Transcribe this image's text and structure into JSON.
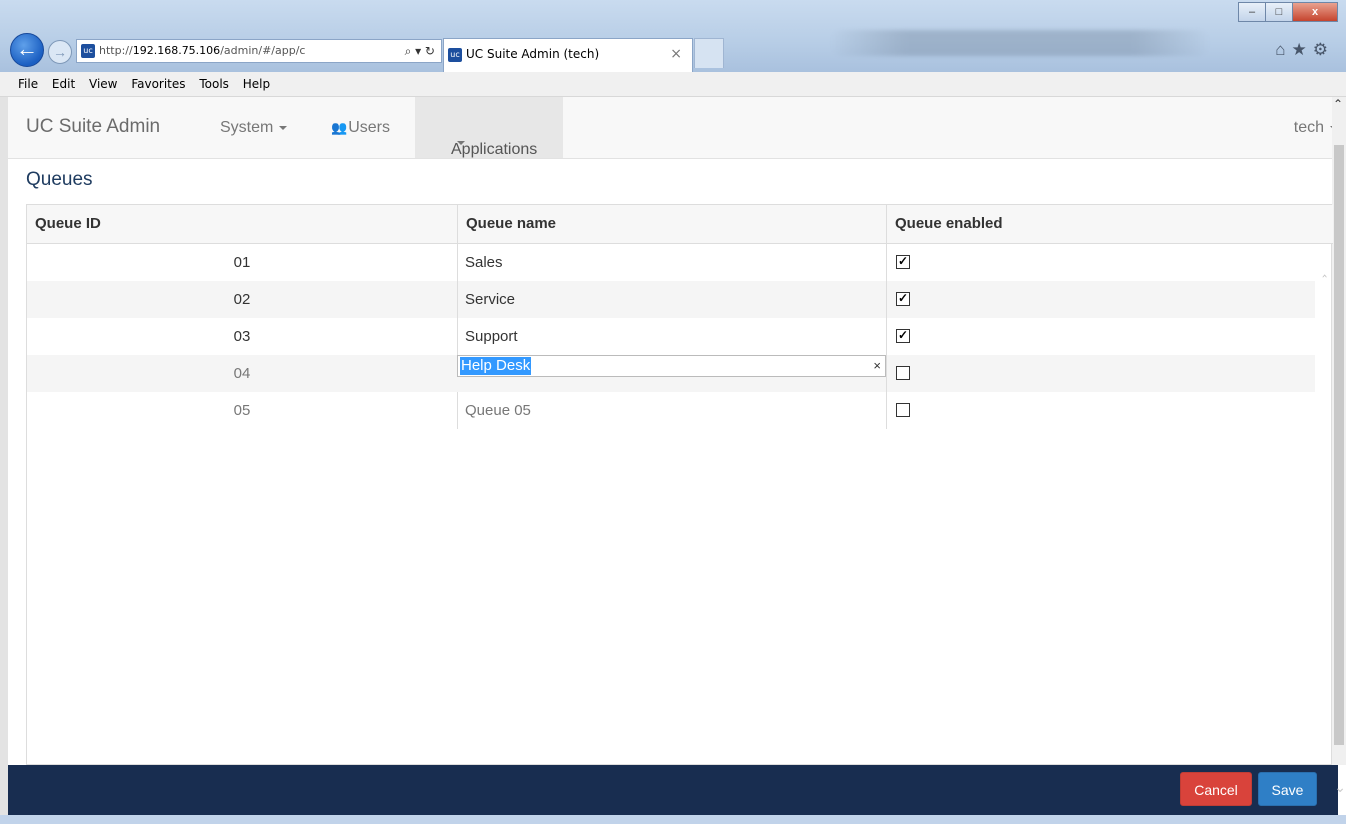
{
  "browser": {
    "address_prefix": "http://",
    "address_host": "192.168.75.106",
    "address_path": "/admin/#/app/c",
    "address_controls": "⌕ ▾ ↻",
    "favicon_text": "uc",
    "tab_title": "UC Suite Admin (tech)",
    "tab_close": "×",
    "window_minimize": "–",
    "window_maximize": "□",
    "window_close": "x",
    "tools_icons": "⌂★⚙"
  },
  "menu": {
    "items": [
      "File",
      "Edit",
      "View",
      "Favorites",
      "Tools",
      "Help"
    ]
  },
  "navbar": {
    "brand": "UC Suite Admin",
    "system": "System",
    "users": "Users",
    "applications": "Applications",
    "user": "tech"
  },
  "page": {
    "title": "Queues"
  },
  "grid": {
    "columns": [
      "Queue ID",
      "Queue name",
      "Queue enabled"
    ],
    "rows": [
      {
        "id": "01",
        "name": "Sales",
        "enabled": true
      },
      {
        "id": "02",
        "name": "Service",
        "enabled": true
      },
      {
        "id": "03",
        "name": "Support",
        "enabled": true
      },
      {
        "id": "04",
        "name": "Help Desk",
        "enabled": false,
        "editing": true
      },
      {
        "id": "05",
        "name": "Queue 05",
        "enabled": false
      }
    ],
    "clear_glyph": "×",
    "check_glyph": "✓",
    "scroll_up_glyph": "‸"
  },
  "footer": {
    "cancel": "Cancel",
    "save": "Save"
  }
}
